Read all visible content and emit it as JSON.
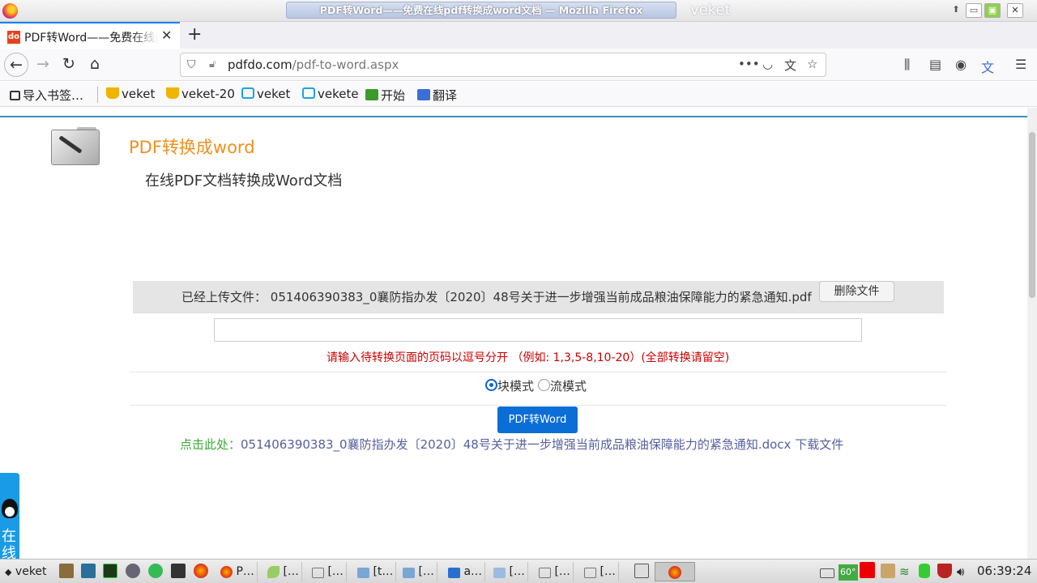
{
  "window": {
    "title": "PDF转Word——免费在线pdf转换成word文档 — Mozilla Firefox",
    "workspace": "veket",
    "buttons": {
      "min": "▭",
      "max": "▣",
      "close": "✕"
    }
  },
  "tabs": [
    {
      "title": "PDF转Word——免费在线pdf转换成word文档",
      "favicon": "do"
    }
  ],
  "newtab_label": "+",
  "nav": {
    "back": "←",
    "forward": "→",
    "reload": "↻",
    "home": "⌂",
    "url_domain": "pdfdo.com",
    "url_path": "/pdf-to-word.aspx",
    "more": "•••"
  },
  "bookmarks": [
    {
      "label": "导入书签…",
      "icon": "import-icon",
      "color": "#333"
    },
    {
      "label": "veket",
      "icon": "trophy-icon",
      "color": "#f0b400"
    },
    {
      "label": "veket-20",
      "icon": "trophy-icon",
      "color": "#f0b400"
    },
    {
      "label": "veket",
      "icon": "tv-icon",
      "color": "#1fa2e0"
    },
    {
      "label": "vekete",
      "icon": "tv-icon",
      "color": "#1fa2e0"
    },
    {
      "label": "开始",
      "icon": "hao-icon",
      "color": "#3a9a2a"
    },
    {
      "label": "翻译",
      "icon": "translate-icon",
      "color": "#3a6fd8"
    }
  ],
  "page": {
    "heading": "PDF转换成word",
    "subheading": "在线PDF文档转换成Word文档",
    "uploaded_label": "已经上传文件：",
    "uploaded_file": "051406390383_0襄防指办发〔2020〕48号关于进一步增强当前成品粮油保障能力的紧急通知.pdf",
    "delete_button": "删除文件",
    "pages_input_value": "",
    "pages_hint": "请输入待转换页面的页码以逗号分开 （例如: 1,3,5-8,10-20）(全部转换请留空)",
    "mode_block": "块模式",
    "mode_flow": "流模式",
    "selected_mode": "block",
    "convert_button": "PDF转Word",
    "download_prefix": "点击此处：",
    "download_file": "051406390383_0襄防指办发〔2020〕48号关于进一步增强当前成品粮油保障能力的紧急通知.docx",
    "download_label": "下载文件"
  },
  "qq_widget": {
    "text": "在线"
  },
  "taskbar": {
    "start_label": "veket",
    "windows": [
      {
        "label": "P…",
        "icon": "firefox-icon"
      },
      {
        "label": "[…",
        "icon": "leaf-icon"
      },
      {
        "label": "[…",
        "icon": "window-icon"
      },
      {
        "label": "[t…",
        "icon": "folder-icon"
      },
      {
        "label": "[…",
        "icon": "folder-icon"
      },
      {
        "label": "a…",
        "icon": "folder-blue-icon"
      },
      {
        "label": "[…",
        "icon": "folder-open-icon"
      },
      {
        "label": "[…",
        "icon": "window-icon"
      },
      {
        "label": "[…",
        "icon": "window-icon"
      }
    ],
    "temp": "60°",
    "clock": "06:39:24"
  }
}
